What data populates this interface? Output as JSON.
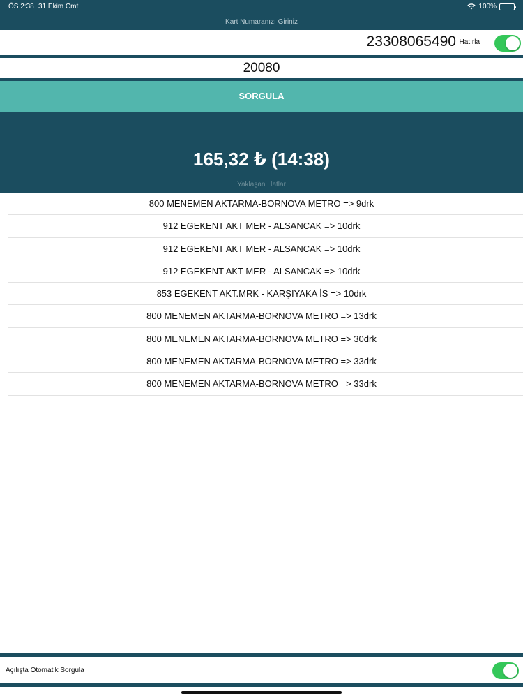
{
  "status_bar": {
    "time": "ÖS 2:38",
    "date": "31 Ekim Cmt",
    "battery": "100%"
  },
  "header": {
    "card_prompt": "Kart Numaranızı Giriniz"
  },
  "card": {
    "number": "23308065490",
    "remember_label": "Hatırla",
    "remember_on": true
  },
  "stop": {
    "value": "20080"
  },
  "query_button": {
    "label": "SORGULA"
  },
  "balance": {
    "text": "165,32 ₺ (14:38)"
  },
  "upcoming": {
    "title": "Yaklaşan Hatlar",
    "items": [
      "800 MENEMEN AKTARMA-BORNOVA METRO => 9drk",
      "912 EGEKENT AKT MER - ALSANCAK => 10drk",
      "912 EGEKENT AKT MER - ALSANCAK => 10drk",
      "912 EGEKENT AKT MER - ALSANCAK => 10drk",
      "853 EGEKENT AKT.MRK - KARŞIYAKA İS => 10drk",
      "800 MENEMEN AKTARMA-BORNOVA METRO => 13drk",
      "800 MENEMEN AKTARMA-BORNOVA METRO => 30drk",
      "800 MENEMEN AKTARMA-BORNOVA METRO => 33drk",
      "800 MENEMEN AKTARMA-BORNOVA METRO => 33drk"
    ]
  },
  "auto_query": {
    "label": "Açılışta Otomatik Sorgula",
    "on": true
  },
  "colors": {
    "band": "#1b4d5f",
    "button": "#52b6ad",
    "toggle_on": "#34c759"
  },
  "icons": {
    "wifi": "wifi-icon",
    "battery": "battery-icon"
  }
}
